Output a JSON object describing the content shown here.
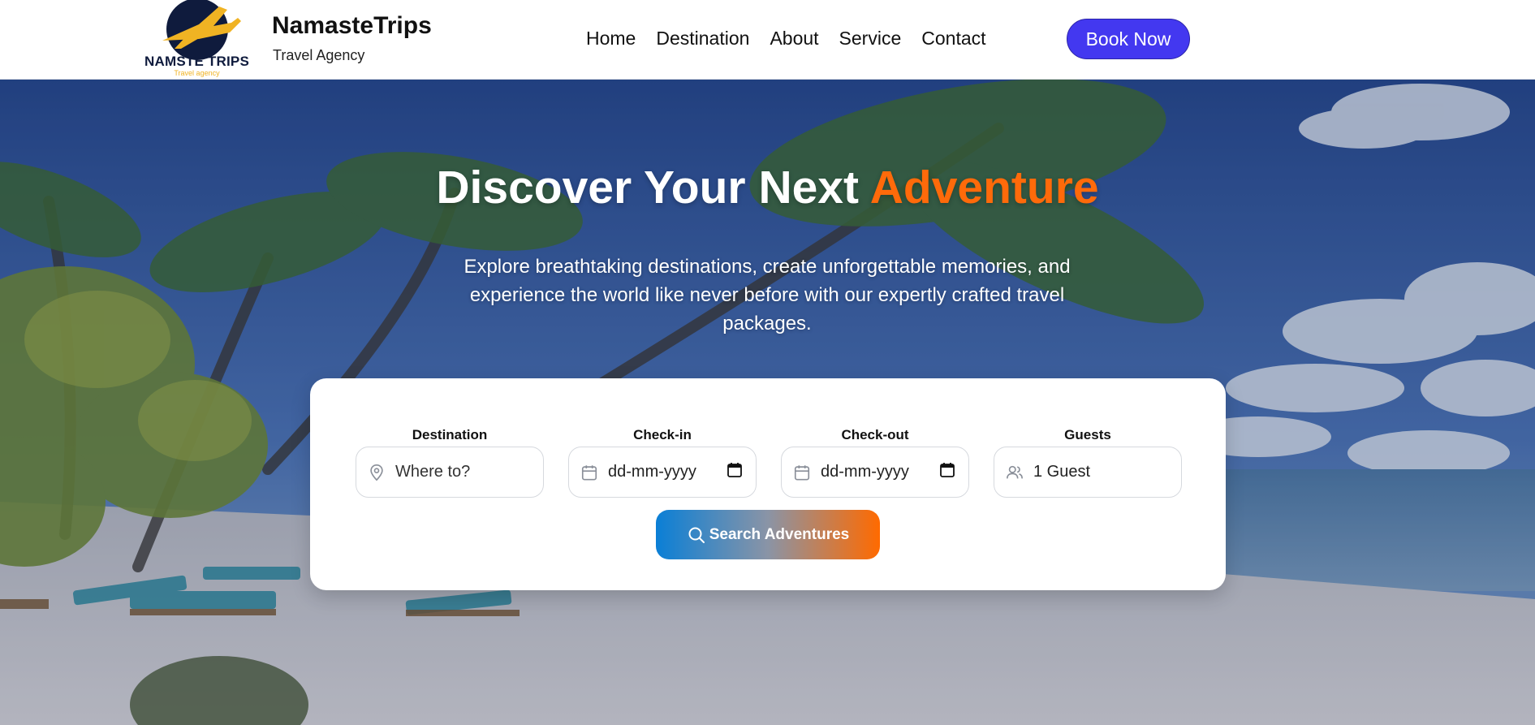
{
  "header": {
    "logo_text": "NAMSTE TRIPS",
    "logo_sub": "Travel agency",
    "brand_name": "NamasteTrips",
    "brand_tag": "Travel Agency",
    "nav": [
      "Home",
      "Destination",
      "About",
      "Service",
      "Contact"
    ],
    "book_label": "Book Now"
  },
  "hero": {
    "title_main": "Discover Your Next ",
    "title_accent": "Adventure",
    "subtitle": "Explore breathtaking destinations, create unforgettable memories, and experience the world like never before with our expertly crafted travel packages."
  },
  "search": {
    "destination": {
      "label": "Destination",
      "placeholder": "Where to?",
      "icon": "map-pin-icon"
    },
    "checkin": {
      "label": "Check-in",
      "value": "dd-mm-yyyy",
      "icon": "calendar-icon"
    },
    "checkout": {
      "label": "Check-out",
      "value": "dd-mm-yyyy",
      "icon": "calendar-icon"
    },
    "guests": {
      "label": "Guests",
      "value": "1 Guest",
      "icon": "users-icon"
    },
    "button_label": "Search Adventures"
  },
  "colors": {
    "accent_orange": "#ff6a0a",
    "book_blue": "#4338f0",
    "logo_navy": "#0f1b3d",
    "logo_yellow": "#f0b323"
  }
}
